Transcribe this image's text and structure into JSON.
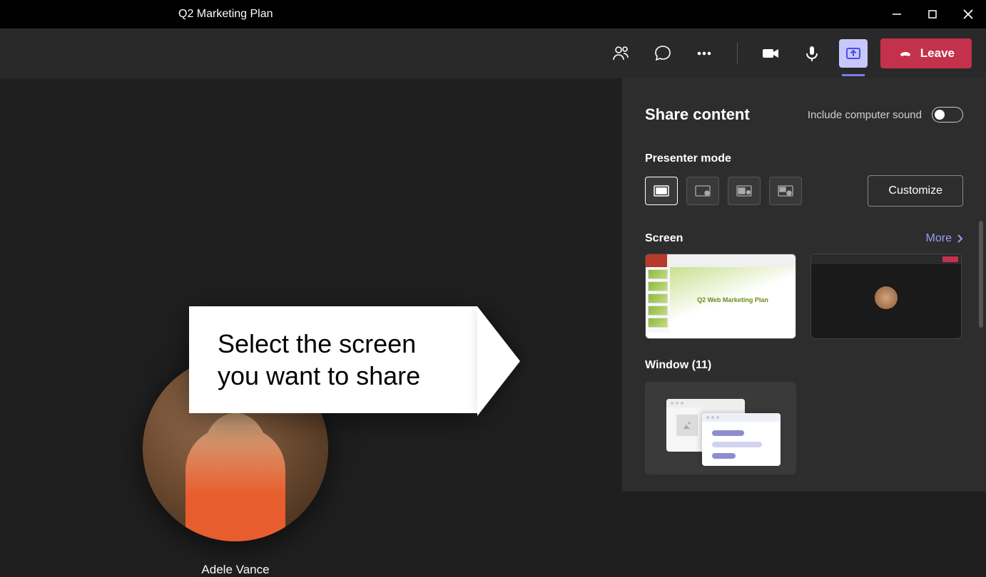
{
  "titlebar": {
    "title": "Q2 Marketing Plan"
  },
  "toolbar": {
    "leave_label": "Leave"
  },
  "participant": {
    "name": "Adele Vance"
  },
  "callout": {
    "line1": "Select the screen",
    "line2": "you want to share"
  },
  "share": {
    "title": "Share content",
    "include_sound": "Include computer sound",
    "presenter_mode": "Presenter mode",
    "customize": "Customize",
    "screen": "Screen",
    "more": "More",
    "window": "Window (11)",
    "thumb_ppt_title": "Q2 Web Marketing Plan"
  }
}
